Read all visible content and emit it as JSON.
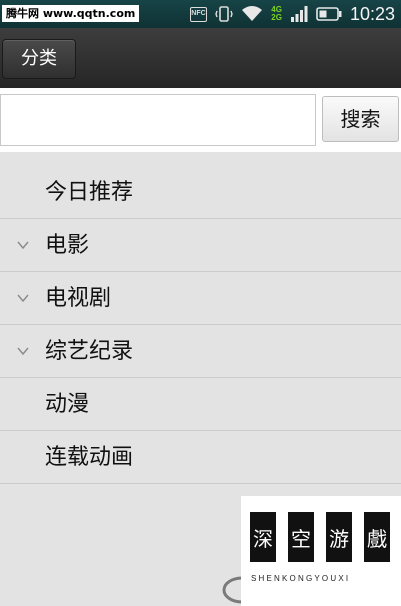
{
  "status_bar": {
    "watermark": "腾牛网 www.qqtn.com",
    "nfc_label": "NFC",
    "network_labels": [
      "4G",
      "2G"
    ],
    "time": "10:23"
  },
  "action_bar": {
    "category_label": "分类"
  },
  "search": {
    "value": "",
    "button_label": "搜索"
  },
  "categories": [
    {
      "label": "今日推荐",
      "expandable": false
    },
    {
      "label": "电影",
      "expandable": true
    },
    {
      "label": "电视剧",
      "expandable": true
    },
    {
      "label": "综艺纪录",
      "expandable": true
    },
    {
      "label": "动漫",
      "expandable": false
    },
    {
      "label": "连载动画",
      "expandable": false
    }
  ],
  "brand": {
    "chars": [
      "深",
      "空",
      "游",
      "戲"
    ],
    "pinyin": "SHENKONGYOUXI"
  },
  "colors": {
    "status_bar": "#123a3c",
    "action_bar": "#2f2f2f",
    "list_background": "#e3e3e3",
    "network_badge": "#7ed321"
  }
}
